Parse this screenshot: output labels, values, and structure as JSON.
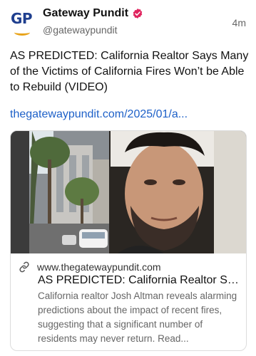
{
  "account": {
    "avatar_text": "GP",
    "display_name": "Gateway Pundit",
    "handle": "@gatewaypundit",
    "verified": true
  },
  "post": {
    "time": "4m",
    "text": "AS PREDICTED: California Realtor Says Many of the Victims of California Fires Won’t be Able to Rebuild (VIDEO)",
    "link_text": "thegatewaypundit.com/2025/01/a..."
  },
  "link_card": {
    "domain": "www.thegatewaypundit.com",
    "title": "AS PREDICTED: California Realtor Say...",
    "description": "California realtor Josh Altman reveals alarming predictions about the impact of recent fires, suggesting that a significant number of residents may never return. Read..."
  },
  "colors": {
    "link": "#1d60c8",
    "verified_badge": "#e0245e",
    "brand_gold": "#e8a319",
    "brand_blue": "#1f3f8f"
  },
  "icons": {
    "verified": "verified-badge-icon",
    "link": "link-icon"
  }
}
